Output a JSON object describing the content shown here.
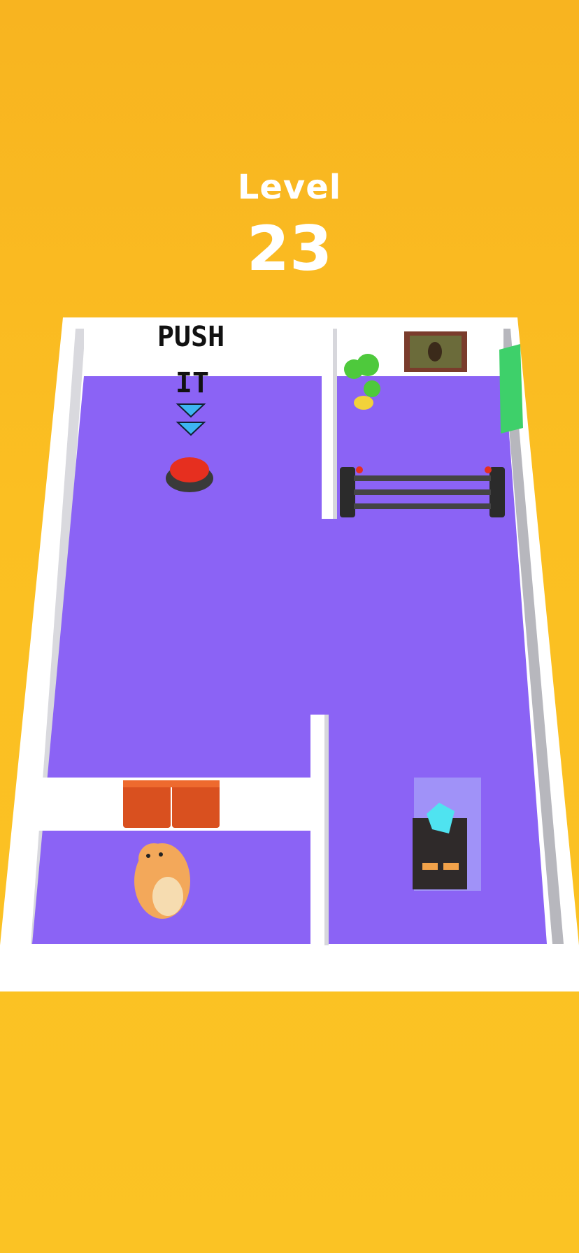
{
  "hud": {
    "level_label": "Level",
    "level_number": "23"
  },
  "sign": {
    "line1": "PUSH",
    "line2": "IT"
  },
  "colors": {
    "background": "#fbbf22",
    "floor": "#8b63f5",
    "wall": "#ffffff",
    "button": "#e62f1f"
  },
  "icons": [
    "arrow-down-icon",
    "push-button",
    "hamster-character",
    "laser-gate",
    "diamond-display",
    "potted-plant",
    "painting",
    "door"
  ]
}
